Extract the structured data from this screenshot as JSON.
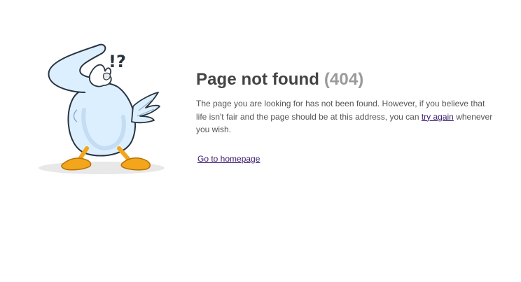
{
  "error": {
    "title": "Page not found",
    "code": "(404)",
    "description_before_link": "The page you are looking for has not been found. However, if you believe that life isn't fair and the page should be at this address, you can ",
    "retry_link_label": "try again",
    "description_after_link": " whenever you wish.",
    "homepage_link_label": "Go to homepage"
  },
  "mascot": {
    "exclamation_text": "!?"
  },
  "colors": {
    "title": "#444444",
    "code": "#9a9a9a",
    "text": "#555555",
    "link": "#3b1c6e",
    "bird_body": "#dcefff",
    "bird_outline": "#2a3440",
    "feet": "#f3a51c"
  }
}
